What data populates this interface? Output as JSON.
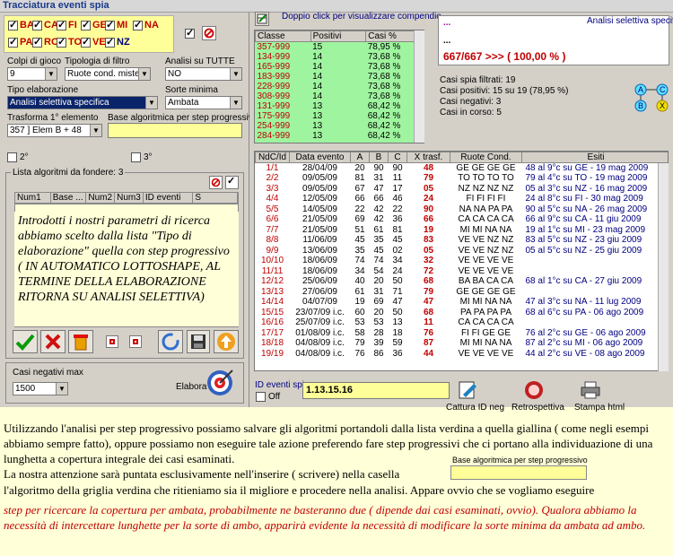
{
  "window": {
    "title": "Tracciatura eventi spia"
  },
  "ruote": [
    {
      "label": "BA",
      "checked": true
    },
    {
      "label": "CA",
      "checked": true
    },
    {
      "label": "FI",
      "checked": true
    },
    {
      "label": "GE",
      "checked": true
    },
    {
      "label": "MI",
      "checked": true
    },
    {
      "label": "NA",
      "checked": true
    },
    {
      "label": "PA",
      "checked": true
    },
    {
      "label": "RO",
      "checked": true
    },
    {
      "label": "TO",
      "checked": true
    },
    {
      "label": "VE",
      "checked": true
    },
    {
      "label": "NZ",
      "checked": true
    }
  ],
  "form": {
    "colpi_label": "Colpi di gioco",
    "colpi_value": "9",
    "tipologia_label": "Tipologia di filtro",
    "tipologia_value": "Ruote cond. miste",
    "analisi_tutte_label": "Analisi su TUTTE",
    "analisi_tutte_value": "NO",
    "tipo_elab_label": "Tipo elaborazione",
    "tipo_elab_value": "Analisi selettiva specifica",
    "sorte_label": "Sorte minima",
    "sorte_value": "Ambata",
    "trasforma_label": "Trasforma 1° elemento",
    "trasforma_value": "357 ] Elem B + 48",
    "base_label": "Base algoritmica per step progressivo",
    "opt2": "2°",
    "opt3": "3°",
    "lista_label": "Lista algoritmi da fondere: 3",
    "lista_cols": [
      "Num1",
      "Base ...",
      "Num2",
      "Num3",
      "ID eventi",
      "S"
    ],
    "casi_neg_label": "Casi negativi max",
    "casi_neg_value": "1500",
    "elabora_label": "Elabora"
  },
  "note_text": "Introdotti i nostri parametri di ricerca abbiamo scelto dalla lista \"Tipo di elaborazione\" quella con step progressivo ( IN AUTOMATICO LOTTOSHAPE, AL TERMINE DELLA ELABORAZIONE RITORNA SU ANALISI SELETTIVA)",
  "compendio_hint": "Doppio click per visualizzare compendio",
  "green_table": {
    "cols": [
      "Classe",
      "Positivi",
      "Casi %"
    ],
    "rows": [
      [
        "357-999",
        "15",
        "78,95 %"
      ],
      [
        "134-999",
        "14",
        "73,68 %"
      ],
      [
        "165-999",
        "14",
        "73,68 %"
      ],
      [
        "183-999",
        "14",
        "73,68 %"
      ],
      [
        "228-999",
        "14",
        "73,68 %"
      ],
      [
        "308-999",
        "14",
        "73,68 %"
      ],
      [
        "131-999",
        "13",
        "68,42 %"
      ],
      [
        "175-999",
        "13",
        "68,42 %"
      ],
      [
        "254-999",
        "13",
        "68,42 %"
      ],
      [
        "284-999",
        "13",
        "68,42 %"
      ]
    ]
  },
  "result": {
    "dots": "...",
    "dots2": "...",
    "analisi": "Analisi selettiva specifica",
    "ratio": "667/667 >>> ( 100,00 % )",
    "casi_filtrati": "Casi spia filtrati: 19",
    "casi_positivi": "Casi positivi: 15 su 19 (78,95 %)",
    "casi_negativi": "Casi negativi: 3",
    "casi_corso": "Casi in corso: 5"
  },
  "main_table": {
    "cols": [
      "NdC/Id",
      "Data evento",
      "A",
      "B",
      "C",
      "X trasf.",
      "Ruote Cond.",
      "Esiti"
    ],
    "rows": [
      [
        "1/1",
        "28/04/09",
        "20",
        "90",
        "90",
        "48",
        "GE GE GE GE",
        "48 al 9°c su GE - 19 mag 2009"
      ],
      [
        "2/2",
        "09/05/09",
        "81",
        "31",
        "11",
        "79",
        "TO TO TO TO",
        "79 al 4°c su TO - 19 mag 2009"
      ],
      [
        "3/3",
        "09/05/09",
        "67",
        "47",
        "17",
        "05",
        "NZ NZ NZ NZ",
        "05 al 3°c su NZ - 16 mag 2009"
      ],
      [
        "4/4",
        "12/05/09",
        "66",
        "66",
        "46",
        "24",
        "FI FI FI FI",
        "24 al 8°c su FI - 30 mag 2009"
      ],
      [
        "5/5",
        "14/05/09",
        "22",
        "42",
        "22",
        "90",
        "NA NA PA PA",
        "90 al 5°c su NA - 26 mag 2009"
      ],
      [
        "6/6",
        "21/05/09",
        "69",
        "42",
        "36",
        "66",
        "CA CA CA CA",
        "66 al 9°c su CA - 11 giu 2009"
      ],
      [
        "7/7",
        "21/05/09",
        "51",
        "61",
        "81",
        "19",
        "MI MI NA NA",
        "19 al 1°c su MI - 23 mag 2009"
      ],
      [
        "8/8",
        "11/06/09",
        "45",
        "35",
        "45",
        "83",
        "VE VE NZ NZ",
        "83 al 5°c su NZ - 23 giu 2009"
      ],
      [
        "9/9",
        "13/06/09",
        "35",
        "45",
        "02",
        "05",
        "VE VE NZ NZ",
        "05 al 5°c su NZ - 25 giu 2009"
      ],
      [
        "10/10",
        "18/06/09",
        "74",
        "74",
        "34",
        "32",
        "VE VE VE VE",
        ""
      ],
      [
        "11/11",
        "18/06/09",
        "34",
        "54",
        "24",
        "72",
        "VE VE VE VE",
        ""
      ],
      [
        "12/12",
        "25/06/09",
        "40",
        "20",
        "50",
        "68",
        "BA BA CA CA",
        "68 al 1°c su CA - 27 giu 2009"
      ],
      [
        "13/13",
        "27/06/09",
        "61",
        "31",
        "71",
        "79",
        "GE GE GE GE",
        ""
      ],
      [
        "14/14",
        "04/07/09",
        "19",
        "69",
        "47",
        "47",
        "MI MI NA NA",
        "47 al 3°c su NA - 11 lug 2009"
      ],
      [
        "15/15",
        "23/07/09 i.c.",
        "60",
        "20",
        "50",
        "68",
        "PA PA PA PA",
        "68 al 6°c su PA - 06 ago 2009"
      ],
      [
        "16/16",
        "25/07/09 i.c.",
        "53",
        "53",
        "13",
        "11",
        "CA CA CA CA",
        ""
      ],
      [
        "17/17",
        "01/08/09 i.c.",
        "58",
        "28",
        "18",
        "76",
        "FI FI GE GE",
        "76 al 2°c su GE - 06 ago 2009"
      ],
      [
        "18/18",
        "04/08/09 i.c.",
        "79",
        "39",
        "59",
        "87",
        "MI MI NA NA",
        "87 al 2°c su MI - 06 ago 2009"
      ],
      [
        "19/19",
        "04/08/09 i.c.",
        "76",
        "86",
        "36",
        "44",
        "VE VE VE VE",
        "44 al 2°c su VE - 08 ago 2009"
      ]
    ]
  },
  "bottom": {
    "id_label": "ID eventi spia",
    "id_value": "1.13.15.16",
    "off_label": "Off",
    "cattura": "Cattura ID neg",
    "retro": "Retrospettiva",
    "stampa": "Stampa html"
  },
  "captions": {
    "p1": "Utilizzando l'analisi per step progressivo possiamo salvare gli algoritmi portandoli dalla lista verdina a quella giallina ( come negli esempi abbiamo sempre fatto), oppure possiamo non eseguire tale azione preferendo fare step progressivi che ci portano alla individuazione di una lunghetta a copertura integrale dei casi esaminati.",
    "p2a": "La nostra attenzione sarà puntata esclusivamente nell'inserire ( scrivere) nella casella",
    "p2_label": "Base algoritmica per step progressivo",
    "p2b": "l'algoritmo della griglia verdina che ritieniamo sia il migliore e procedere nella analisi. Appare ovvio che se vogliamo eseguire",
    "p3": "step per ricercare la copertura per ambata, probabilmente ne basteranno due ( dipende dai casi esaminati, ovvio). Qualora abbiamo la necessità di intercettare lunghette per la sorte di ambo, apparirà evidente la necessità di modificare la sorte minima da ambata ad ambo."
  }
}
